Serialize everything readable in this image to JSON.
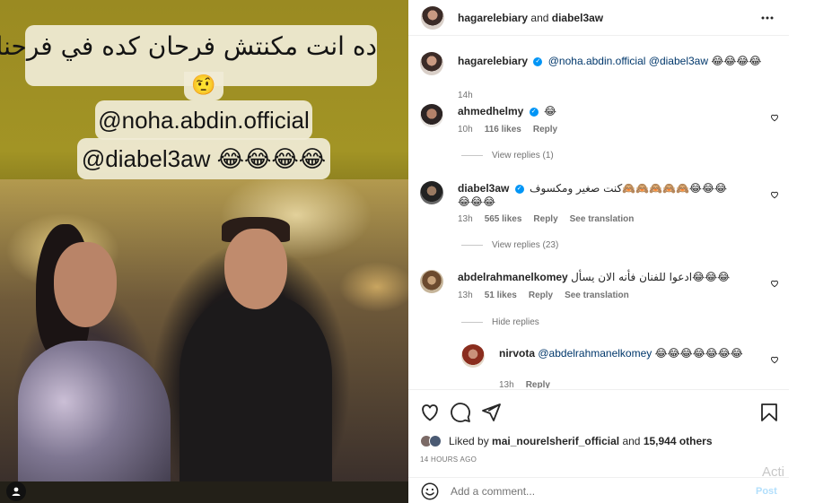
{
  "media": {
    "caption_arabic": "ده انت مكنتش فرحان كده في فرحنا",
    "caption_emoji": "🤨",
    "caption_mention1": "@noha.abdin.official",
    "caption_mention2": "@diabel3aw 😂😂😂😂"
  },
  "header": {
    "owner": "hagarelebiary",
    "and_text": "and",
    "collaborator": "diabel3aw",
    "more_icon": "more-horizontal-icon"
  },
  "caption": {
    "username": "hagarelebiary",
    "mention1": "@noha.abdin.official",
    "mention2": "@diabel3aw",
    "emojis": "😂😂😂😂",
    "time": "14h"
  },
  "comments": [
    {
      "username": "ahmedhelmy",
      "text": "😂",
      "time": "10h",
      "likes": "116 likes",
      "reply": "Reply",
      "replies_toggle": "View replies (1)"
    },
    {
      "username": "diabel3aw",
      "text": "كنت صغير ومكسوف🙈🙈🙈🙈🙈😂😂😂😂😂😂",
      "time": "13h",
      "likes": "565 likes",
      "reply": "Reply",
      "translation": "See translation",
      "replies_toggle": "View replies (23)"
    },
    {
      "username": "abdelrahmanelkomey",
      "text": "ادعوا للفنان فأنه الان يسأل😂😂😂",
      "time": "13h",
      "likes": "51 likes",
      "reply": "Reply",
      "translation": "See translation",
      "replies_toggle": "Hide replies"
    }
  ],
  "reply": {
    "username": "nirvota",
    "mention": "@abdelrahmanelkomey",
    "emojis": "😂😂😂😂😂😂😂",
    "time": "13h",
    "reply": "Reply"
  },
  "likes": {
    "prefix": "Liked by",
    "user": "mai_nourelsherif_official",
    "and_text": "and",
    "others": "15,944 others",
    "timestamp": "14 HOURS AGO"
  },
  "add_comment": {
    "placeholder": "Add a comment...",
    "post_label": "Post"
  },
  "watermark": "Acti"
}
